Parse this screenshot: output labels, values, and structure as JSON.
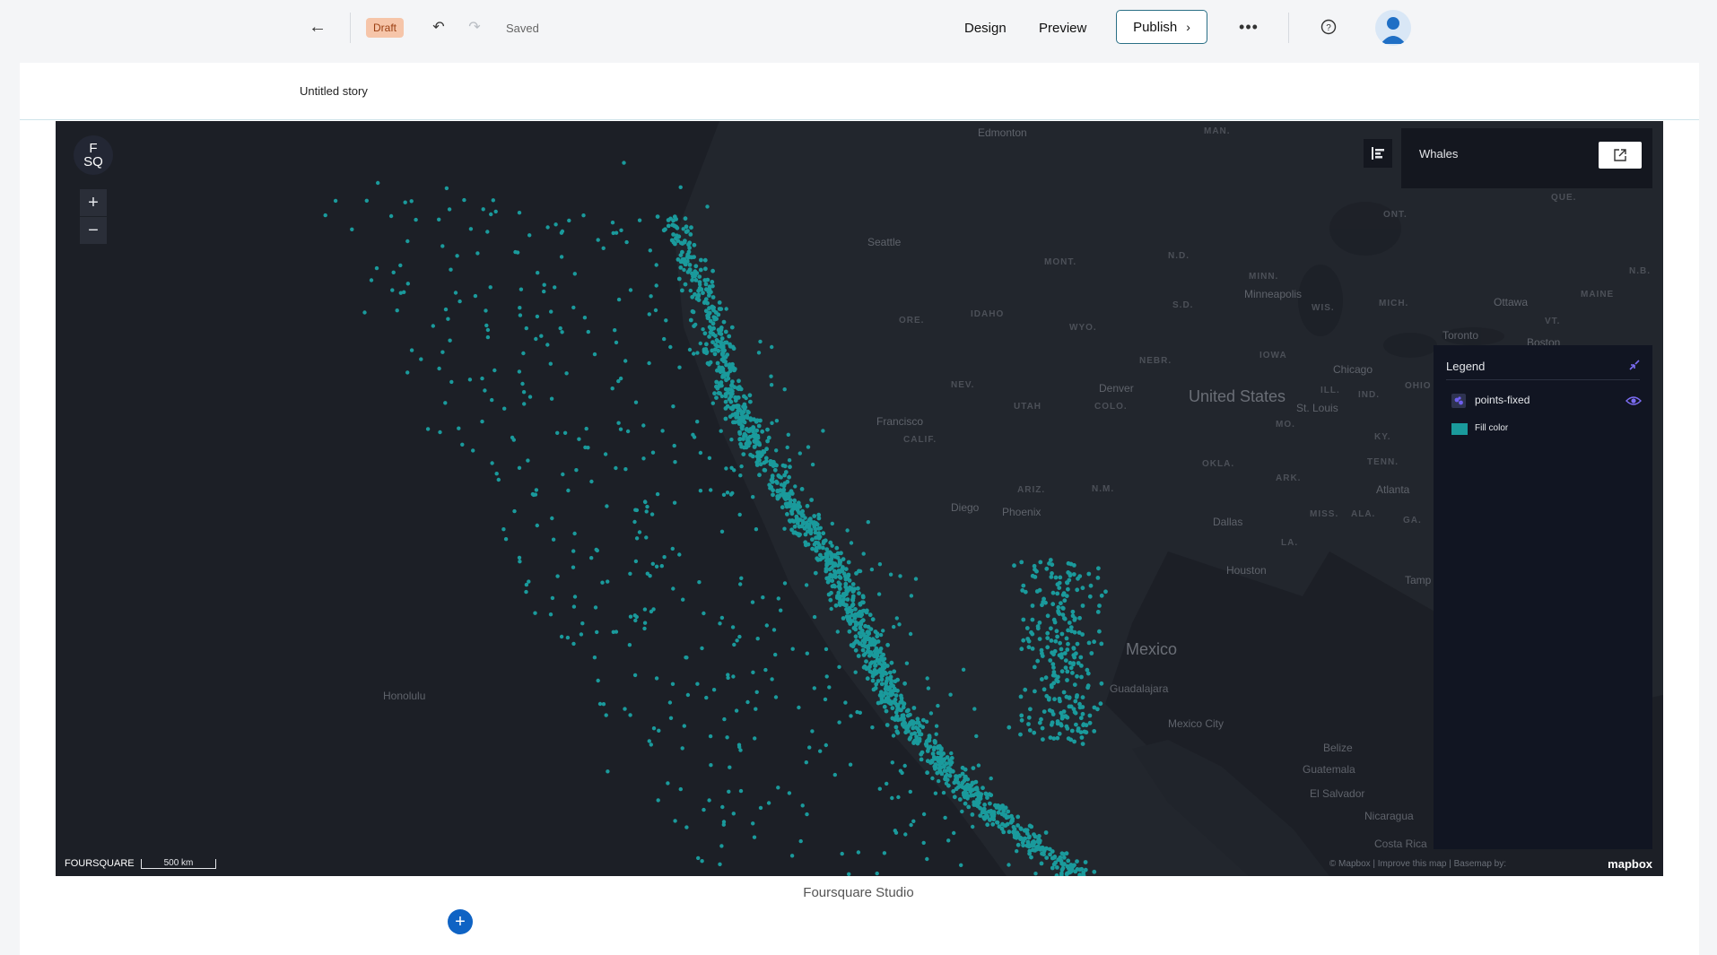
{
  "topbar": {
    "back_icon": "arrow-left-icon",
    "status_badge": "Draft",
    "undo_icon": "undo-icon",
    "redo_icon": "redo-icon",
    "save_status": "Saved",
    "tabs": [
      {
        "label": "Design"
      },
      {
        "label": "Preview"
      }
    ],
    "publish_label": "Publish",
    "more_icon": "more-horizontal-icon",
    "help_icon": "help-circle-icon",
    "avatar_icon": "user-avatar-icon"
  },
  "story": {
    "title": "Untitled story",
    "caption": "Foursquare Studio",
    "add_block_icon": "plus-icon"
  },
  "map": {
    "logo_line1": "F",
    "logo_line2": "SQ",
    "zoom_in": "+",
    "zoom_out": "−",
    "panel_title": "Whales",
    "brand": "FOURSQUARE",
    "scale_label": "500 km",
    "mapbox_attribution": "© Mapbox | Improve this map | Basemap by:",
    "mapbox_logo": "mapbox",
    "point_color": "#1a9a9c",
    "labels": {
      "edmonton": "Edmonton",
      "seattle": "Seattle",
      "san_francisco": "Francisco",
      "san_diego": "Diego",
      "phoenix": "Phoenix",
      "denver": "Denver",
      "minneapolis": "Minneapolis",
      "chicago": "Chicago",
      "st_louis": "St. Louis",
      "dallas": "Dallas",
      "houston": "Houston",
      "atlanta": "Atlanta",
      "ottawa": "Ottawa",
      "toronto": "Toronto",
      "boston": "Boston",
      "tampa": "Tamp",
      "honolulu": "Honolulu",
      "guadalajara": "Guadalajara",
      "mexico_city": "Mexico City",
      "belize": "Belize",
      "guatemala": "Guatemala",
      "el_salvador": "El Salvador",
      "nicaragua": "Nicaragua",
      "costa_rica": "Costa Rica",
      "united_states": "United States",
      "mexico": "Mexico"
    },
    "states": {
      "man": "MAN.",
      "ont": "ONT.",
      "que": "QUE.",
      "nd": "N.D.",
      "mont": "MONT.",
      "minn": "MINN.",
      "sd": "S.D.",
      "wis": "WIS.",
      "mich": "MICH.",
      "nb": "N.B.",
      "maine": "MAINE",
      "vt": "VT.",
      "idaho": "IDAHO",
      "ore": "ORE.",
      "wyo": "WYO.",
      "iowa": "IOWA",
      "nebr": "NEBR.",
      "nev": "NEV.",
      "utah": "UTAH",
      "colo": "COLO.",
      "ill": "ILL.",
      "ind": "IND.",
      "ohio": "OHIO",
      "mo": "MO.",
      "calif": "CALIF.",
      "ky": "KY.",
      "ariz": "ARIZ.",
      "nm": "N.M.",
      "okla": "OKLA.",
      "ark": "ARK.",
      "tenn": "TENN.",
      "miss": "MISS.",
      "ala": "ALA.",
      "ga": "GA.",
      "la": "LA."
    }
  },
  "legend": {
    "title": "Legend",
    "collapse_icon": "collapse-icon",
    "layer_name": "points-fixed",
    "layer_icon": "point-layer-icon",
    "visibility_icon": "eye-icon",
    "swatch_label": "Fill color",
    "swatch_color": "#1a9a9c"
  }
}
